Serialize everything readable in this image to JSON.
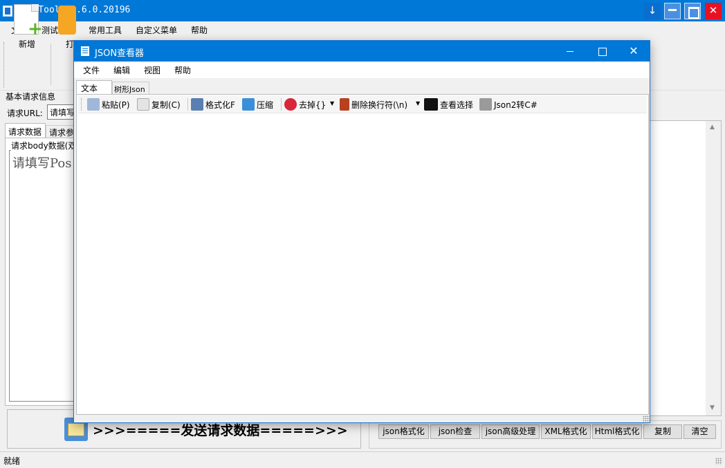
{
  "main_window": {
    "title": "HttpTools 1.6.0.20196",
    "menu": [
      "文件",
      "测试功能",
      "常用工具",
      "自定义菜单",
      "帮助"
    ],
    "toolbar": {
      "new_label": "新增",
      "open_label": "打"
    },
    "basic_info_label": "基本请求信息",
    "url": {
      "label": "请求URL:",
      "value": "请填写"
    },
    "tabs": {
      "request_data": "请求数据",
      "request_params": "请求参"
    },
    "body_group_label": "请求body数据(双",
    "body_placeholder": "请填写Pos",
    "send_label": ">>>=====发送请求数据=====>>>",
    "response_buttons": [
      "json格式化",
      "json检查",
      "json高级处理",
      "XML格式化",
      "Html格式化",
      "复制",
      "清空"
    ],
    "status": "就绪"
  },
  "json_viewer": {
    "title": "JSON查看器",
    "menu": [
      "文件",
      "编辑",
      "视图",
      "帮助"
    ],
    "tabs": {
      "text": "文本",
      "tree": "树形Json"
    },
    "toolbar": {
      "paste": "粘贴(P)",
      "copy": "复制(C)",
      "format": "格式化F",
      "compress": "压缩",
      "remove_braces": "去掉{}",
      "remove_newlines": "删除换行符(\\n)",
      "view_selection": "查看选择",
      "json_to_csharp": "Json2转C#"
    }
  },
  "colors": {
    "titlebar": "#0078d7",
    "close_red": "#e81123"
  }
}
